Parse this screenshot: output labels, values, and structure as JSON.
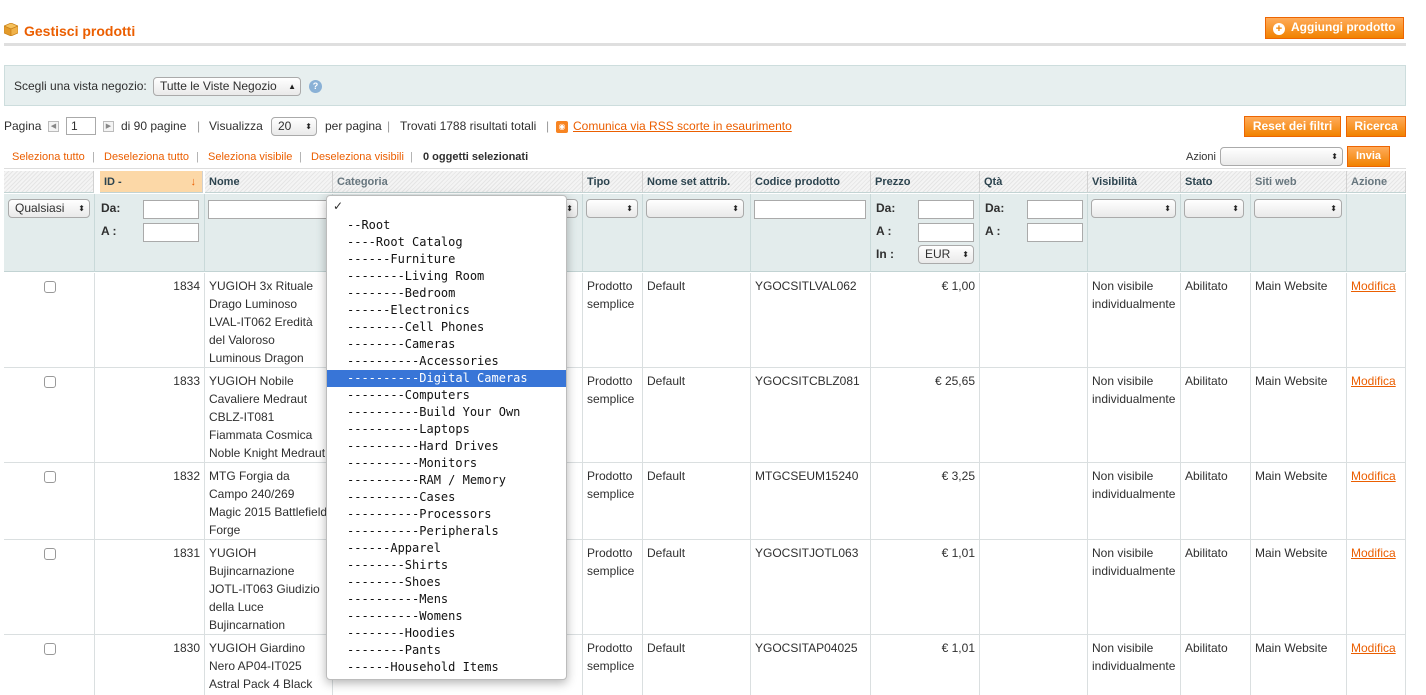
{
  "header": {
    "title": "Gestisci prodotti",
    "add_button": "Aggiungi prodotto"
  },
  "store_switcher": {
    "label": "Scegli una vista negozio:",
    "value": "Tutte le Viste Negozio",
    "help": "?"
  },
  "pager": {
    "page_label": "Pagina",
    "page_value": "1",
    "of_pages": "di 90 pagine",
    "view_label": "Visualizza",
    "per_page_value": "20",
    "per_page_label": "per pagina",
    "found": "Trovati 1788 risultati totali",
    "rss_link": "Comunica via RSS scorte in esaurimento",
    "reset_button": "Reset dei filtri",
    "search_button": "Ricerca"
  },
  "massaction": {
    "select_all": "Seleziona tutto",
    "deselect_all": "Deseleziona tutto",
    "select_visible": "Seleziona visibile",
    "deselect_visible": "Deseleziona visibili",
    "selected_count": "0 oggetti selezionati",
    "actions_label": "Azioni",
    "submit": "Invia"
  },
  "grid": {
    "columns": [
      "ID",
      "Nome",
      "Categoria",
      "Tipo",
      "Nome set attrib.",
      "Codice prodotto",
      "Prezzo",
      "Qtà",
      "Visibilità",
      "Stato",
      "Siti web",
      "Azione"
    ],
    "filters": {
      "any": "Qualsiasi",
      "from": "Da:",
      "to": "A :",
      "in": "In :",
      "currency": "EUR"
    },
    "rows": [
      {
        "id": "1834",
        "name": "YUGIOH 3x Rituale Drago Luminoso LVAL-IT062 Eredità del Valoroso Luminous Dragon",
        "type": "Prodotto semplice",
        "set": "Default",
        "sku": "YGOCSITLVAL062",
        "price": "€ 1,00",
        "visibility": "Non visibile individualmente",
        "status": "Abilitato",
        "website": "Main Website",
        "action": "Modifica"
      },
      {
        "id": "1833",
        "name": "YUGIOH Nobile Cavaliere Medraut CBLZ-IT081 Fiammata Cosmica Noble Knight Medraut",
        "type": "Prodotto semplice",
        "set": "Default",
        "sku": "YGOCSITCBLZ081",
        "price": "€ 25,65",
        "visibility": "Non visibile individualmente",
        "status": "Abilitato",
        "website": "Main Website",
        "action": "Modifica"
      },
      {
        "id": "1832",
        "name": "MTG Forgia da Campo 240/269 Magic 2015 Battlefield Forge",
        "type": "Prodotto semplice",
        "set": "Default",
        "sku": "MTGCSEUM15240",
        "price": "€ 3,25",
        "visibility": "Non visibile individualmente",
        "status": "Abilitato",
        "website": "Main Website",
        "action": "Modifica"
      },
      {
        "id": "1831",
        "name": "YUGIOH Bujincarnazione JOTL-IT063 Giudizio della Luce Bujincarnation",
        "type": "Prodotto semplice",
        "set": "Default",
        "sku": "YGOCSITJOTL063",
        "price": "€ 1,01",
        "visibility": "Non visibile individualmente",
        "status": "Abilitato",
        "website": "Main Website",
        "action": "Modifica"
      },
      {
        "id": "1830",
        "name": "YUGIOH Giardino Nero AP04-IT025 Astral Pack 4 Black",
        "type": "Prodotto semplice",
        "set": "Default",
        "sku": "YGOCSITAP04025",
        "price": "€ 1,01",
        "visibility": "Non visibile individualmente",
        "status": "Abilitato",
        "website": "Main Website",
        "action": "Modifica"
      }
    ]
  },
  "category_dropdown": {
    "check": "✓",
    "selected": "----------Digital Cameras",
    "options": [
      "--Root",
      "----Root Catalog",
      "------Furniture",
      "--------Living Room",
      "--------Bedroom",
      "------Electronics",
      "--------Cell Phones",
      "--------Cameras",
      "----------Accessories",
      "----------Digital Cameras",
      "--------Computers",
      "----------Build Your Own",
      "----------Laptops",
      "----------Hard Drives",
      "----------Monitors",
      "----------RAM / Memory",
      "----------Cases",
      "----------Processors",
      "----------Peripherals",
      "------Apparel",
      "--------Shirts",
      "--------Shoes",
      "----------Mens",
      "----------Womens",
      "--------Hoodies",
      "--------Pants",
      "------Household Items"
    ]
  }
}
